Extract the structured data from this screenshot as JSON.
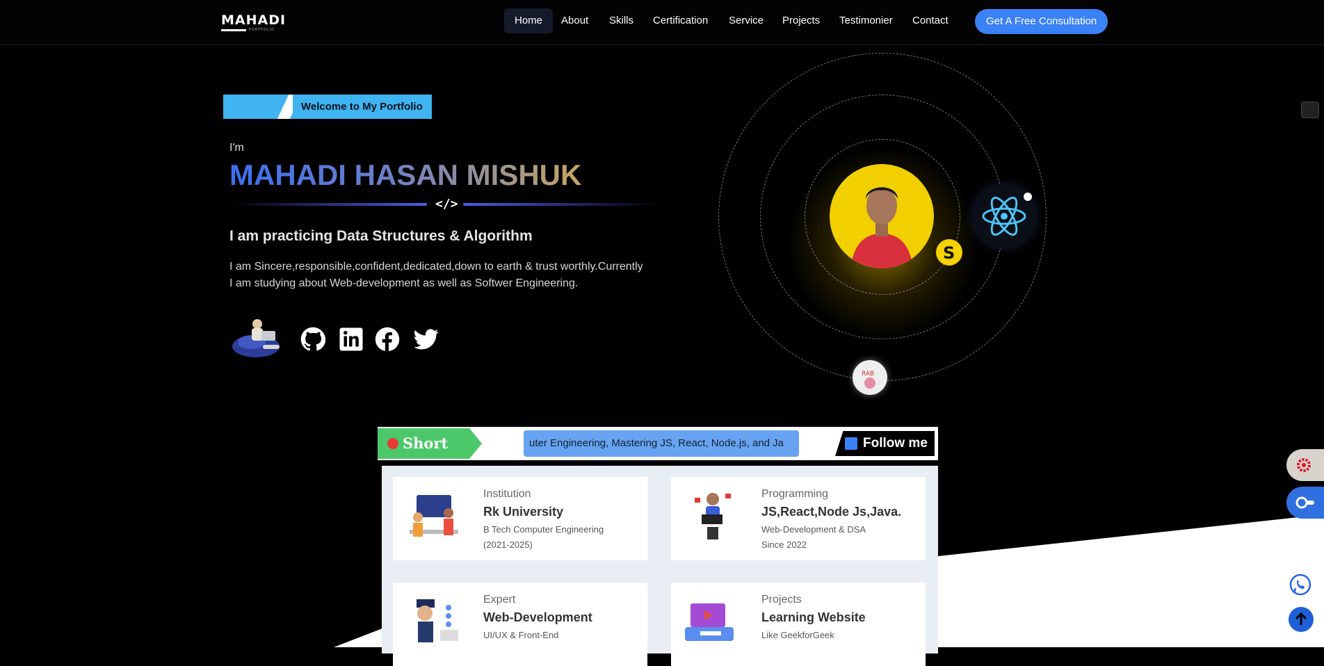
{
  "nav": {
    "logo": "MAHADI",
    "logo_sub": "PORTFOLIO",
    "links": [
      "Home",
      "About",
      "Skills",
      "Certification",
      "Service",
      "Projects",
      "Testimonier",
      "Contact"
    ],
    "active": "Home",
    "cta": "Get A Free Consultation"
  },
  "hero": {
    "welcome": "Welcome to My Portfolio",
    "greeting": "I'm",
    "name": "MAHADI HASAN MISHUK",
    "code_symbol": "</>",
    "tagline": "I am practicing Data Structures & Algorithm",
    "bio_line1": "I am Sincere,responsible,confident,dedicated,down to earth & trust worthly.Currently",
    "bio_line2": "I am studying about Web-development as well as Softwer Engineering.",
    "social_icons": [
      "github-icon",
      "linkedin-icon",
      "facebook-icon",
      "twitter-icon"
    ]
  },
  "intro": {
    "tag": "Short Intro",
    "ticker": "uter Engineering, Mastering JS, React, Node.js, and Ja",
    "follow": "Follow me"
  },
  "cards": [
    {
      "label": "Institution",
      "title": "Rk University",
      "desc1": "B Tech Computer Engineering",
      "desc2": "(2021-2025)"
    },
    {
      "label": "Programming",
      "title": "JS,React,Node Js,Java.",
      "desc1": "Web-Development & DSA",
      "desc2": "Since 2022"
    },
    {
      "label": "Expert",
      "title": "Web-Development",
      "desc1": "UI/UX & Front-End",
      "desc2": ""
    },
    {
      "label": "Projects",
      "title": "Learning Website",
      "desc1": "Like GeekforGeek",
      "desc2": ""
    }
  ],
  "colors": {
    "accent": "#3b82f6",
    "intro_green": "#4cc86a",
    "ticker_blue": "#67a3f0",
    "avatar_yellow": "#f2d000"
  }
}
